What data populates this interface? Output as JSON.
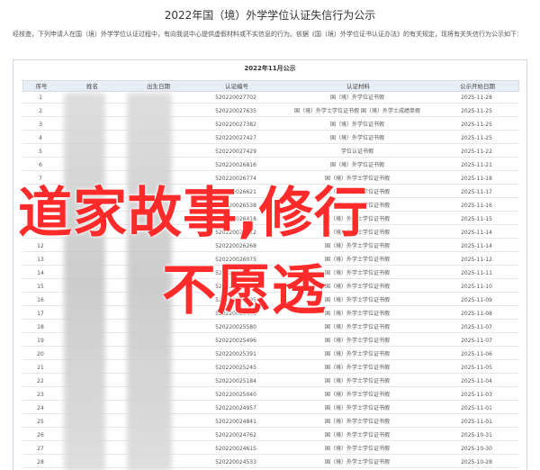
{
  "title": "2022年国（境）外学学位认证失信行为公示",
  "intro": "经核查，下列申请人在国（境）外学学位认证过程中，有向我说中心提供虚假材料或不实信息的行为。依据《国（境）外学位证书认证办法》的有关规定，现将有关失信行为公示如下：",
  "table": {
    "title": "2022年11月公示",
    "headers": [
      "序号",
      "姓名",
      "出生日期",
      "认证编号",
      "认证材料",
      "公示开始日期"
    ],
    "rows": [
      {
        "no": "1",
        "code": "520220027702",
        "material": "国（境）外学位证书假",
        "date": "2025-11-28"
      },
      {
        "no": "2",
        "code": "520220027635",
        "material": "国（境）外学士学位证书假 国（境）外学士成绩单假",
        "date": "2025-11-25"
      },
      {
        "no": "3",
        "code": "520220027382",
        "material": "国（境）外学位证书假",
        "date": "2025-11-25"
      },
      {
        "no": "4",
        "code": "520220027427",
        "material": "国（境）外学位证书假",
        "date": "2025-11-25"
      },
      {
        "no": "5",
        "code": "520220027429",
        "material": "学位认证书假",
        "date": "2025-11-22"
      },
      {
        "no": "6",
        "code": "520220026816",
        "material": "国（境）外学位证书假",
        "date": "2025-11-21"
      },
      {
        "no": "7",
        "code": "520220026774",
        "material": "国（境）外学士学位证书假",
        "date": "2025-11-18"
      },
      {
        "no": "8",
        "code": "520220026621",
        "material": "国（境）外学士学位证书假",
        "date": "2025-11-17"
      },
      {
        "no": "9",
        "code": "520220026538",
        "material": "国（境）外学士学位证书假",
        "date": "2025-11-16"
      },
      {
        "no": "10",
        "code": "520220026418",
        "material": "国（境）外学士学位证书假",
        "date": "2025-11-15"
      },
      {
        "no": "11",
        "code": "520220026312",
        "material": "国（境）外学士学位证书假",
        "date": "2025-11-14"
      },
      {
        "no": "12",
        "code": "520220026268",
        "material": "国（境）外学士学位证书假",
        "date": "2025-11-14"
      },
      {
        "no": "13",
        "code": "520220026075",
        "material": "国（境）外学士学位证书假",
        "date": "2025-11-12"
      },
      {
        "no": "14",
        "code": "520220026059",
        "material": "国（境）外学士学位证书假",
        "date": "2025-11-11"
      },
      {
        "no": "15",
        "code": "520220025862",
        "material": "国（境）外学士学位证书假",
        "date": "2025-11-10"
      },
      {
        "no": "16",
        "code": "520220025795",
        "material": "国（境）外学士学位证书假",
        "date": "2025-11-09"
      },
      {
        "no": "17",
        "code": "520220025656",
        "material": "国（境）外学士学位证书假",
        "date": "2025-11-08"
      },
      {
        "no": "18",
        "code": "520220025580",
        "material": "国（境）外学士学位证书假",
        "date": "2025-11-07"
      },
      {
        "no": "19",
        "code": "520220025496",
        "material": "国（境）外学士学位证书假",
        "date": "2025-11-07"
      },
      {
        "no": "20",
        "code": "520220025391",
        "material": "国（境）外学士学位证书假",
        "date": "2025-11-06"
      },
      {
        "no": "21",
        "code": "520220025245",
        "material": "国（境）外学士学位证书假",
        "date": "2025-11-05"
      },
      {
        "no": "22",
        "code": "520220025184",
        "material": "国（境）外学士学位证书假",
        "date": "2025-11-04"
      },
      {
        "no": "23",
        "code": "520220025040",
        "material": "国（境）外学士学位证书假",
        "date": "2025-11-03"
      },
      {
        "no": "24",
        "code": "520220024957",
        "material": "国（境）外学士学位证书假",
        "date": "2025-11-01"
      },
      {
        "no": "25",
        "code": "520220024841",
        "material": "国（境）外学士学位证书假",
        "date": "2025-11-01"
      },
      {
        "no": "26",
        "code": "520220024762",
        "material": "国（境）外学士学位证书假",
        "date": "2025-10-31"
      },
      {
        "no": "27",
        "code": "520220024615",
        "material": "国（境）外学士学位证书假",
        "date": "2025-10-30"
      },
      {
        "no": "28",
        "code": "520220024533",
        "material": "国（境）外学士学位证书假",
        "date": "2025-10-28"
      }
    ]
  },
  "overlay": {
    "line1": "道家故事,修行",
    "line2": "不愿透",
    "color": "#ff2a2a"
  }
}
